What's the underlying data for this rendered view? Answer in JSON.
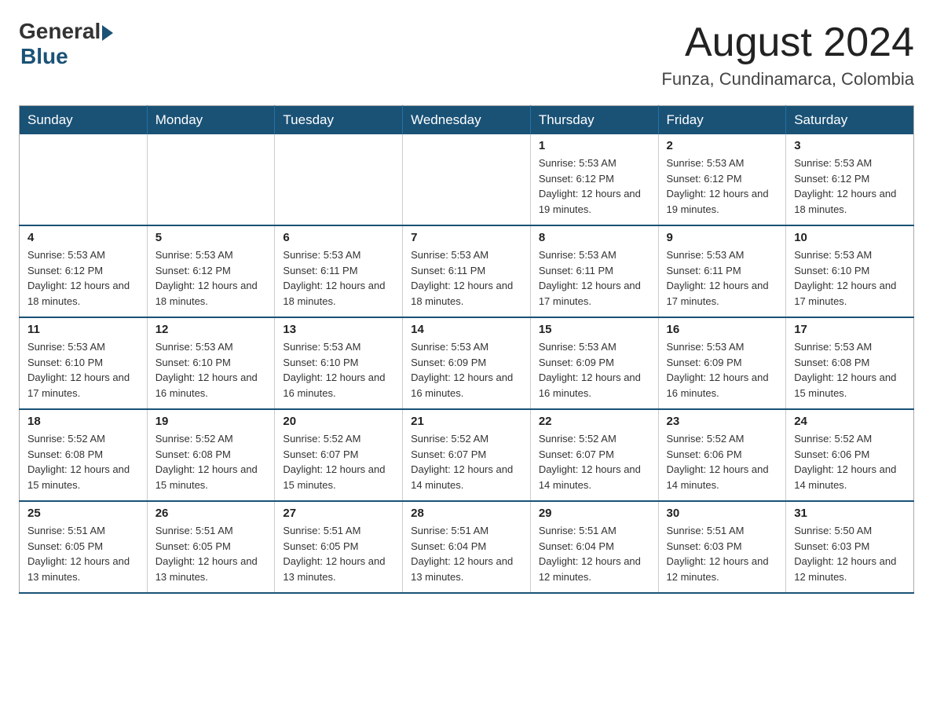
{
  "header": {
    "logo_general": "General",
    "logo_blue": "Blue",
    "month_year": "August 2024",
    "location": "Funza, Cundinamarca, Colombia"
  },
  "days_of_week": [
    "Sunday",
    "Monday",
    "Tuesday",
    "Wednesday",
    "Thursday",
    "Friday",
    "Saturday"
  ],
  "weeks": [
    [
      {
        "day": "",
        "info": ""
      },
      {
        "day": "",
        "info": ""
      },
      {
        "day": "",
        "info": ""
      },
      {
        "day": "",
        "info": ""
      },
      {
        "day": "1",
        "info": "Sunrise: 5:53 AM\nSunset: 6:12 PM\nDaylight: 12 hours and 19 minutes."
      },
      {
        "day": "2",
        "info": "Sunrise: 5:53 AM\nSunset: 6:12 PM\nDaylight: 12 hours and 19 minutes."
      },
      {
        "day": "3",
        "info": "Sunrise: 5:53 AM\nSunset: 6:12 PM\nDaylight: 12 hours and 18 minutes."
      }
    ],
    [
      {
        "day": "4",
        "info": "Sunrise: 5:53 AM\nSunset: 6:12 PM\nDaylight: 12 hours and 18 minutes."
      },
      {
        "day": "5",
        "info": "Sunrise: 5:53 AM\nSunset: 6:12 PM\nDaylight: 12 hours and 18 minutes."
      },
      {
        "day": "6",
        "info": "Sunrise: 5:53 AM\nSunset: 6:11 PM\nDaylight: 12 hours and 18 minutes."
      },
      {
        "day": "7",
        "info": "Sunrise: 5:53 AM\nSunset: 6:11 PM\nDaylight: 12 hours and 18 minutes."
      },
      {
        "day": "8",
        "info": "Sunrise: 5:53 AM\nSunset: 6:11 PM\nDaylight: 12 hours and 17 minutes."
      },
      {
        "day": "9",
        "info": "Sunrise: 5:53 AM\nSunset: 6:11 PM\nDaylight: 12 hours and 17 minutes."
      },
      {
        "day": "10",
        "info": "Sunrise: 5:53 AM\nSunset: 6:10 PM\nDaylight: 12 hours and 17 minutes."
      }
    ],
    [
      {
        "day": "11",
        "info": "Sunrise: 5:53 AM\nSunset: 6:10 PM\nDaylight: 12 hours and 17 minutes."
      },
      {
        "day": "12",
        "info": "Sunrise: 5:53 AM\nSunset: 6:10 PM\nDaylight: 12 hours and 16 minutes."
      },
      {
        "day": "13",
        "info": "Sunrise: 5:53 AM\nSunset: 6:10 PM\nDaylight: 12 hours and 16 minutes."
      },
      {
        "day": "14",
        "info": "Sunrise: 5:53 AM\nSunset: 6:09 PM\nDaylight: 12 hours and 16 minutes."
      },
      {
        "day": "15",
        "info": "Sunrise: 5:53 AM\nSunset: 6:09 PM\nDaylight: 12 hours and 16 minutes."
      },
      {
        "day": "16",
        "info": "Sunrise: 5:53 AM\nSunset: 6:09 PM\nDaylight: 12 hours and 16 minutes."
      },
      {
        "day": "17",
        "info": "Sunrise: 5:53 AM\nSunset: 6:08 PM\nDaylight: 12 hours and 15 minutes."
      }
    ],
    [
      {
        "day": "18",
        "info": "Sunrise: 5:52 AM\nSunset: 6:08 PM\nDaylight: 12 hours and 15 minutes."
      },
      {
        "day": "19",
        "info": "Sunrise: 5:52 AM\nSunset: 6:08 PM\nDaylight: 12 hours and 15 minutes."
      },
      {
        "day": "20",
        "info": "Sunrise: 5:52 AM\nSunset: 6:07 PM\nDaylight: 12 hours and 15 minutes."
      },
      {
        "day": "21",
        "info": "Sunrise: 5:52 AM\nSunset: 6:07 PM\nDaylight: 12 hours and 14 minutes."
      },
      {
        "day": "22",
        "info": "Sunrise: 5:52 AM\nSunset: 6:07 PM\nDaylight: 12 hours and 14 minutes."
      },
      {
        "day": "23",
        "info": "Sunrise: 5:52 AM\nSunset: 6:06 PM\nDaylight: 12 hours and 14 minutes."
      },
      {
        "day": "24",
        "info": "Sunrise: 5:52 AM\nSunset: 6:06 PM\nDaylight: 12 hours and 14 minutes."
      }
    ],
    [
      {
        "day": "25",
        "info": "Sunrise: 5:51 AM\nSunset: 6:05 PM\nDaylight: 12 hours and 13 minutes."
      },
      {
        "day": "26",
        "info": "Sunrise: 5:51 AM\nSunset: 6:05 PM\nDaylight: 12 hours and 13 minutes."
      },
      {
        "day": "27",
        "info": "Sunrise: 5:51 AM\nSunset: 6:05 PM\nDaylight: 12 hours and 13 minutes."
      },
      {
        "day": "28",
        "info": "Sunrise: 5:51 AM\nSunset: 6:04 PM\nDaylight: 12 hours and 13 minutes."
      },
      {
        "day": "29",
        "info": "Sunrise: 5:51 AM\nSunset: 6:04 PM\nDaylight: 12 hours and 12 minutes."
      },
      {
        "day": "30",
        "info": "Sunrise: 5:51 AM\nSunset: 6:03 PM\nDaylight: 12 hours and 12 minutes."
      },
      {
        "day": "31",
        "info": "Sunrise: 5:50 AM\nSunset: 6:03 PM\nDaylight: 12 hours and 12 minutes."
      }
    ]
  ]
}
